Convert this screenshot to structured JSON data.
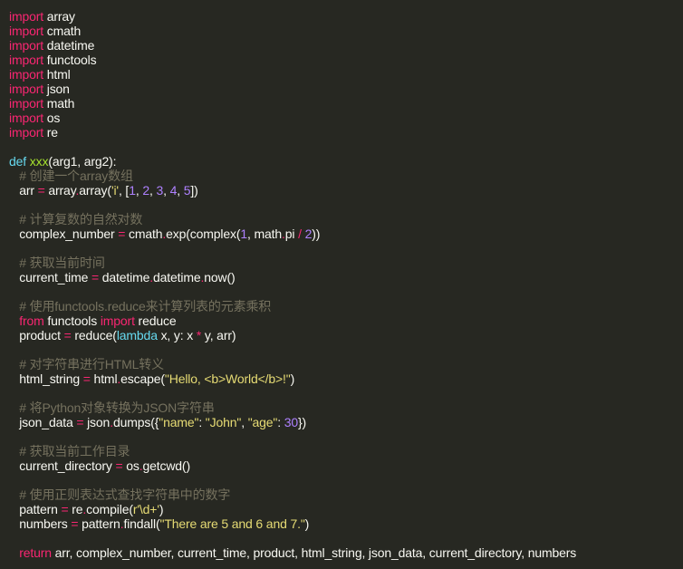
{
  "theme": {
    "background": "#272822",
    "colors": {
      "kw": "#f92672",
      "def": "#66d9ef",
      "fn": "#a6e22e",
      "str": "#e6db74",
      "num": "#ae81ff",
      "cm": "#75715e",
      "op": "#f92672",
      "pl": "#f8f8f2"
    }
  },
  "editor": {
    "lines": [
      [
        [
          "kw",
          "import"
        ],
        [
          "pl",
          " array"
        ]
      ],
      [
        [
          "kw",
          "import"
        ],
        [
          "pl",
          " cmath"
        ]
      ],
      [
        [
          "kw",
          "import"
        ],
        [
          "pl",
          " datetime"
        ]
      ],
      [
        [
          "kw",
          "import"
        ],
        [
          "pl",
          " functools"
        ]
      ],
      [
        [
          "kw",
          "import"
        ],
        [
          "pl",
          " html"
        ]
      ],
      [
        [
          "kw",
          "import"
        ],
        [
          "pl",
          " json"
        ]
      ],
      [
        [
          "kw",
          "import"
        ],
        [
          "pl",
          " math"
        ]
      ],
      [
        [
          "kw",
          "import"
        ],
        [
          "pl",
          " os"
        ]
      ],
      [
        [
          "kw",
          "import"
        ],
        [
          "pl",
          " re"
        ]
      ],
      [],
      [
        [
          "def",
          "def"
        ],
        [
          "pl",
          " "
        ],
        [
          "fn",
          "xxx"
        ],
        [
          "pl",
          "(arg1, arg2):"
        ]
      ],
      [
        [
          "pl",
          "   "
        ],
        [
          "cm",
          "# 创建一个array数组"
        ]
      ],
      [
        [
          "pl",
          "   arr "
        ],
        [
          "op",
          "="
        ],
        [
          "pl",
          " array"
        ],
        [
          "op",
          "."
        ],
        [
          "pl",
          "array("
        ],
        [
          "str",
          "'i'"
        ],
        [
          "pl",
          ", ["
        ],
        [
          "num",
          "1"
        ],
        [
          "pl",
          ", "
        ],
        [
          "num",
          "2"
        ],
        [
          "pl",
          ", "
        ],
        [
          "num",
          "3"
        ],
        [
          "pl",
          ", "
        ],
        [
          "num",
          "4"
        ],
        [
          "pl",
          ", "
        ],
        [
          "num",
          "5"
        ],
        [
          "pl",
          "])"
        ]
      ],
      [],
      [
        [
          "pl",
          "   "
        ],
        [
          "cm",
          "# 计算复数的自然对数"
        ]
      ],
      [
        [
          "pl",
          "   complex_number "
        ],
        [
          "op",
          "="
        ],
        [
          "pl",
          " cmath"
        ],
        [
          "op",
          "."
        ],
        [
          "pl",
          "exp(complex("
        ],
        [
          "num",
          "1"
        ],
        [
          "pl",
          ", math"
        ],
        [
          "op",
          "."
        ],
        [
          "pl",
          "pi "
        ],
        [
          "op",
          "/"
        ],
        [
          "pl",
          " "
        ],
        [
          "num",
          "2"
        ],
        [
          "pl",
          "))"
        ]
      ],
      [],
      [
        [
          "pl",
          "   "
        ],
        [
          "cm",
          "# 获取当前时间"
        ]
      ],
      [
        [
          "pl",
          "   current_time "
        ],
        [
          "op",
          "="
        ],
        [
          "pl",
          " datetime"
        ],
        [
          "op",
          "."
        ],
        [
          "pl",
          "datetime"
        ],
        [
          "op",
          "."
        ],
        [
          "pl",
          "now()"
        ]
      ],
      [],
      [
        [
          "pl",
          "   "
        ],
        [
          "cm",
          "# 使用functools.reduce来计算列表的元素乘积"
        ]
      ],
      [
        [
          "pl",
          "   "
        ],
        [
          "kw",
          "from"
        ],
        [
          "pl",
          " functools "
        ],
        [
          "kw",
          "import"
        ],
        [
          "pl",
          " reduce"
        ]
      ],
      [
        [
          "pl",
          "   product "
        ],
        [
          "op",
          "="
        ],
        [
          "pl",
          " reduce("
        ],
        [
          "def",
          "lambda"
        ],
        [
          "pl",
          " x, y: x "
        ],
        [
          "op",
          "*"
        ],
        [
          "pl",
          " y, arr)"
        ]
      ],
      [],
      [
        [
          "pl",
          "   "
        ],
        [
          "cm",
          "# 对字符串进行HTML转义"
        ]
      ],
      [
        [
          "pl",
          "   html_string "
        ],
        [
          "op",
          "="
        ],
        [
          "pl",
          " html"
        ],
        [
          "op",
          "."
        ],
        [
          "pl",
          "escape("
        ],
        [
          "str",
          "\"Hello, <b>World</b>!\""
        ],
        [
          "pl",
          ")"
        ]
      ],
      [],
      [
        [
          "pl",
          "   "
        ],
        [
          "cm",
          "# 将Python对象转换为JSON字符串"
        ]
      ],
      [
        [
          "pl",
          "   json_data "
        ],
        [
          "op",
          "="
        ],
        [
          "pl",
          " json"
        ],
        [
          "op",
          "."
        ],
        [
          "pl",
          "dumps({"
        ],
        [
          "str",
          "\"name\""
        ],
        [
          "pl",
          ": "
        ],
        [
          "str",
          "\"John\""
        ],
        [
          "pl",
          ", "
        ],
        [
          "str",
          "\"age\""
        ],
        [
          "pl",
          ": "
        ],
        [
          "num",
          "30"
        ],
        [
          "pl",
          "})"
        ]
      ],
      [],
      [
        [
          "pl",
          "   "
        ],
        [
          "cm",
          "# 获取当前工作目录"
        ]
      ],
      [
        [
          "pl",
          "   current_directory "
        ],
        [
          "op",
          "="
        ],
        [
          "pl",
          " os"
        ],
        [
          "op",
          "."
        ],
        [
          "pl",
          "getcwd()"
        ]
      ],
      [],
      [
        [
          "pl",
          "   "
        ],
        [
          "cm",
          "# 使用正则表达式查找字符串中的数字"
        ]
      ],
      [
        [
          "pl",
          "   pattern "
        ],
        [
          "op",
          "="
        ],
        [
          "pl",
          " re"
        ],
        [
          "op",
          "."
        ],
        [
          "pl",
          "compile("
        ],
        [
          "str",
          "r'\\d+'"
        ],
        [
          "pl",
          ")"
        ]
      ],
      [
        [
          "pl",
          "   numbers "
        ],
        [
          "op",
          "="
        ],
        [
          "pl",
          " pattern"
        ],
        [
          "op",
          "."
        ],
        [
          "pl",
          "findall("
        ],
        [
          "str",
          "\"There are 5 and 6 and 7.\""
        ],
        [
          "pl",
          ")"
        ]
      ],
      [],
      [
        [
          "pl",
          "   "
        ],
        [
          "kw",
          "return"
        ],
        [
          "pl",
          " arr, complex_number, current_time, product, html_string, json_data, current_directory, numbers"
        ]
      ]
    ]
  }
}
